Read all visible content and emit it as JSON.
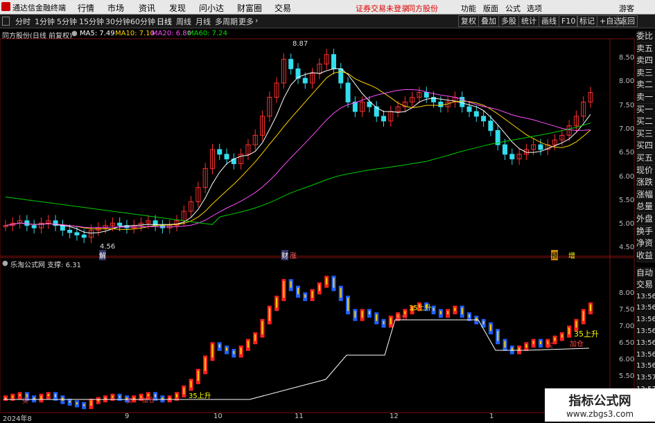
{
  "app": {
    "title": "通达信金融终端"
  },
  "menu": [
    "行情",
    "市场",
    "资讯",
    "发现",
    "问小达",
    "财富圈",
    "交易"
  ],
  "menu_right": [
    "功能",
    "版面",
    "公式",
    "选项",
    "游客"
  ],
  "status": {
    "warning": "证券交易未登录",
    "stock": "同方股份"
  },
  "toolbar": {
    "periods": [
      "分时",
      "1分钟",
      "5分钟",
      "15分钟",
      "30分钟",
      "60分钟",
      "日线",
      "周线",
      "月线",
      "多周期",
      "更多"
    ],
    "active_period": "日线",
    "right_buttons": [
      "复权",
      "叠加",
      "多股",
      "统计",
      "画线",
      "F10",
      "标记",
      "+自选",
      "返回"
    ]
  },
  "main_chart": {
    "stock_label": "同方股份(日线 前复权)",
    "ma": [
      {
        "label": "MA5: 7.49",
        "color": "#ffffff"
      },
      {
        "label": "MA10: 7.10",
        "color": "#ffd200"
      },
      {
        "label": "MA20: 6.80",
        "color": "#ff4fff"
      },
      {
        "label": "MA60: 7.24",
        "color": "#00e000"
      }
    ],
    "high_marker": "8.87",
    "low_marker": "4.56",
    "y_ticks": [
      "8.50",
      "8.00",
      "7.50",
      "7.00",
      "6.50",
      "6.00",
      "5.50",
      "5.00",
      "4.50"
    ],
    "tags": [
      "解",
      "财",
      "涨",
      "预",
      "增"
    ]
  },
  "sub_chart": {
    "label": "乐淘公式网 支撑: 6.31",
    "y_ticks": [
      "8.00",
      "7.50",
      "7.00",
      "6.50",
      "6.00",
      "5.50",
      "5.00"
    ],
    "annotations": [
      "35上升",
      "35上升",
      "35上升",
      "加仓",
      "加仓",
      "加仓",
      "买",
      "买",
      "买"
    ]
  },
  "side_panel": [
    "委比",
    "卖五",
    "卖四",
    "卖三",
    "卖二",
    "卖一",
    "买一",
    "买二",
    "买三",
    "买四",
    "买五",
    "现价",
    "涨跌",
    "涨幅",
    "总量",
    "外盘",
    "换手",
    "净资",
    "收益"
  ],
  "side_panel2": [
    "自动",
    "交易",
    "13:56",
    "13:56",
    "13:56",
    "13:56",
    "13:56",
    "13:56",
    "13:56",
    "13:57",
    "13:57",
    "13:57",
    "13:57"
  ],
  "x_axis": [
    "2024年8",
    "9",
    "10",
    "11",
    "12",
    "1"
  ],
  "watermark": {
    "line1": "指标公式网",
    "line2": "www.zbgs3.com"
  },
  "chart_data": {
    "type": "candlestick",
    "closes": [
      5.0,
      5.05,
      5.1,
      5.0,
      4.95,
      5.05,
      5.1,
      5.0,
      4.9,
      4.85,
      4.8,
      4.75,
      4.9,
      4.95,
      5.0,
      5.05,
      5.0,
      4.95,
      5.0,
      5.05,
      5.1,
      5.0,
      4.95,
      5.0,
      5.1,
      5.3,
      5.5,
      5.8,
      6.2,
      6.6,
      6.5,
      6.4,
      6.3,
      6.5,
      6.7,
      6.9,
      7.3,
      7.7,
      8.0,
      8.5,
      8.3,
      8.1,
      8.0,
      8.2,
      8.4,
      8.6,
      8.3,
      8.0,
      7.6,
      7.4,
      7.6,
      7.5,
      7.3,
      7.2,
      7.4,
      7.5,
      7.6,
      7.7,
      7.8,
      7.7,
      7.6,
      7.5,
      7.6,
      7.7,
      7.5,
      7.4,
      7.3,
      7.2,
      7.0,
      6.7,
      6.5,
      6.4,
      6.5,
      6.6,
      6.7,
      6.6,
      6.7,
      6.8,
      6.9,
      7.1,
      7.3,
      7.6,
      7.8
    ],
    "ma60_start": 5.6
  }
}
